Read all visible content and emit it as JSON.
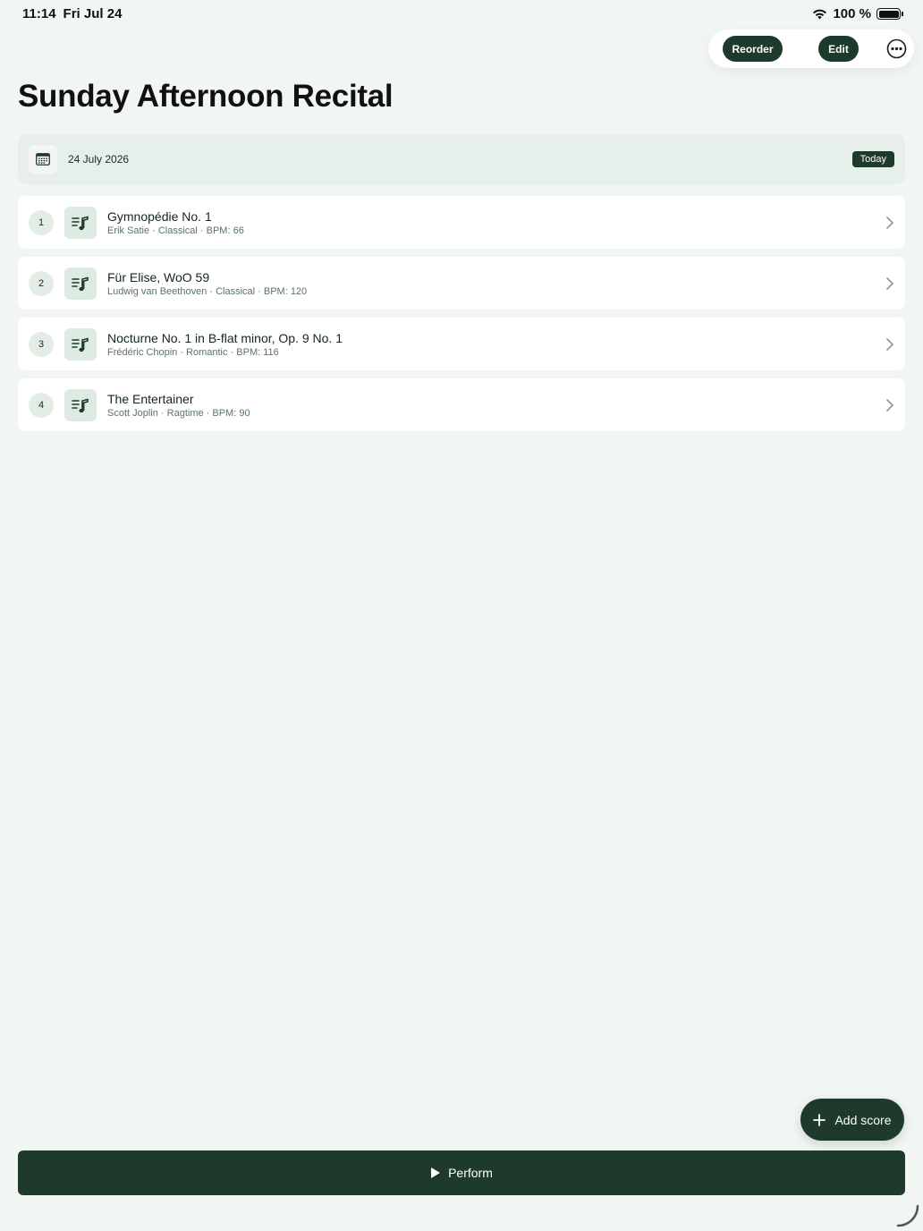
{
  "status_bar": {
    "time": "11:14",
    "date": "Fri Jul 24",
    "battery": "100 %"
  },
  "toolbar": {
    "reorder_label": "Reorder",
    "edit_label": "Edit",
    "more_icon": "ellipsis-circle-icon"
  },
  "page": {
    "title": "Sunday Afternoon Recital"
  },
  "date_card": {
    "date": "24 July 2026",
    "badge": "Today",
    "icon": "calendar-icon"
  },
  "scores": [
    {
      "number": "1",
      "title": "Gymnopédie No. 1",
      "subtitle": "Erik Satie · Classical · BPM: 66"
    },
    {
      "number": "2",
      "title": "Für Elise, WoO 59",
      "subtitle": "Ludwig van Beethoven · Classical · BPM: 120"
    },
    {
      "number": "3",
      "title": "Nocturne No. 1 in B-flat minor, Op. 9 No. 1",
      "subtitle": "Frédéric Chopin · Romantic · BPM: 116"
    },
    {
      "number": "4",
      "title": "The Entertainer",
      "subtitle": "Scott Joplin · Ragtime · BPM: 90"
    }
  ],
  "actions": {
    "add_score_label": "Add score",
    "perform_label": "Perform"
  },
  "colors": {
    "background": "#f2f6f3",
    "accent": "#1d3a2c",
    "card": "#ffffff",
    "date_card": "#e6efe9"
  }
}
